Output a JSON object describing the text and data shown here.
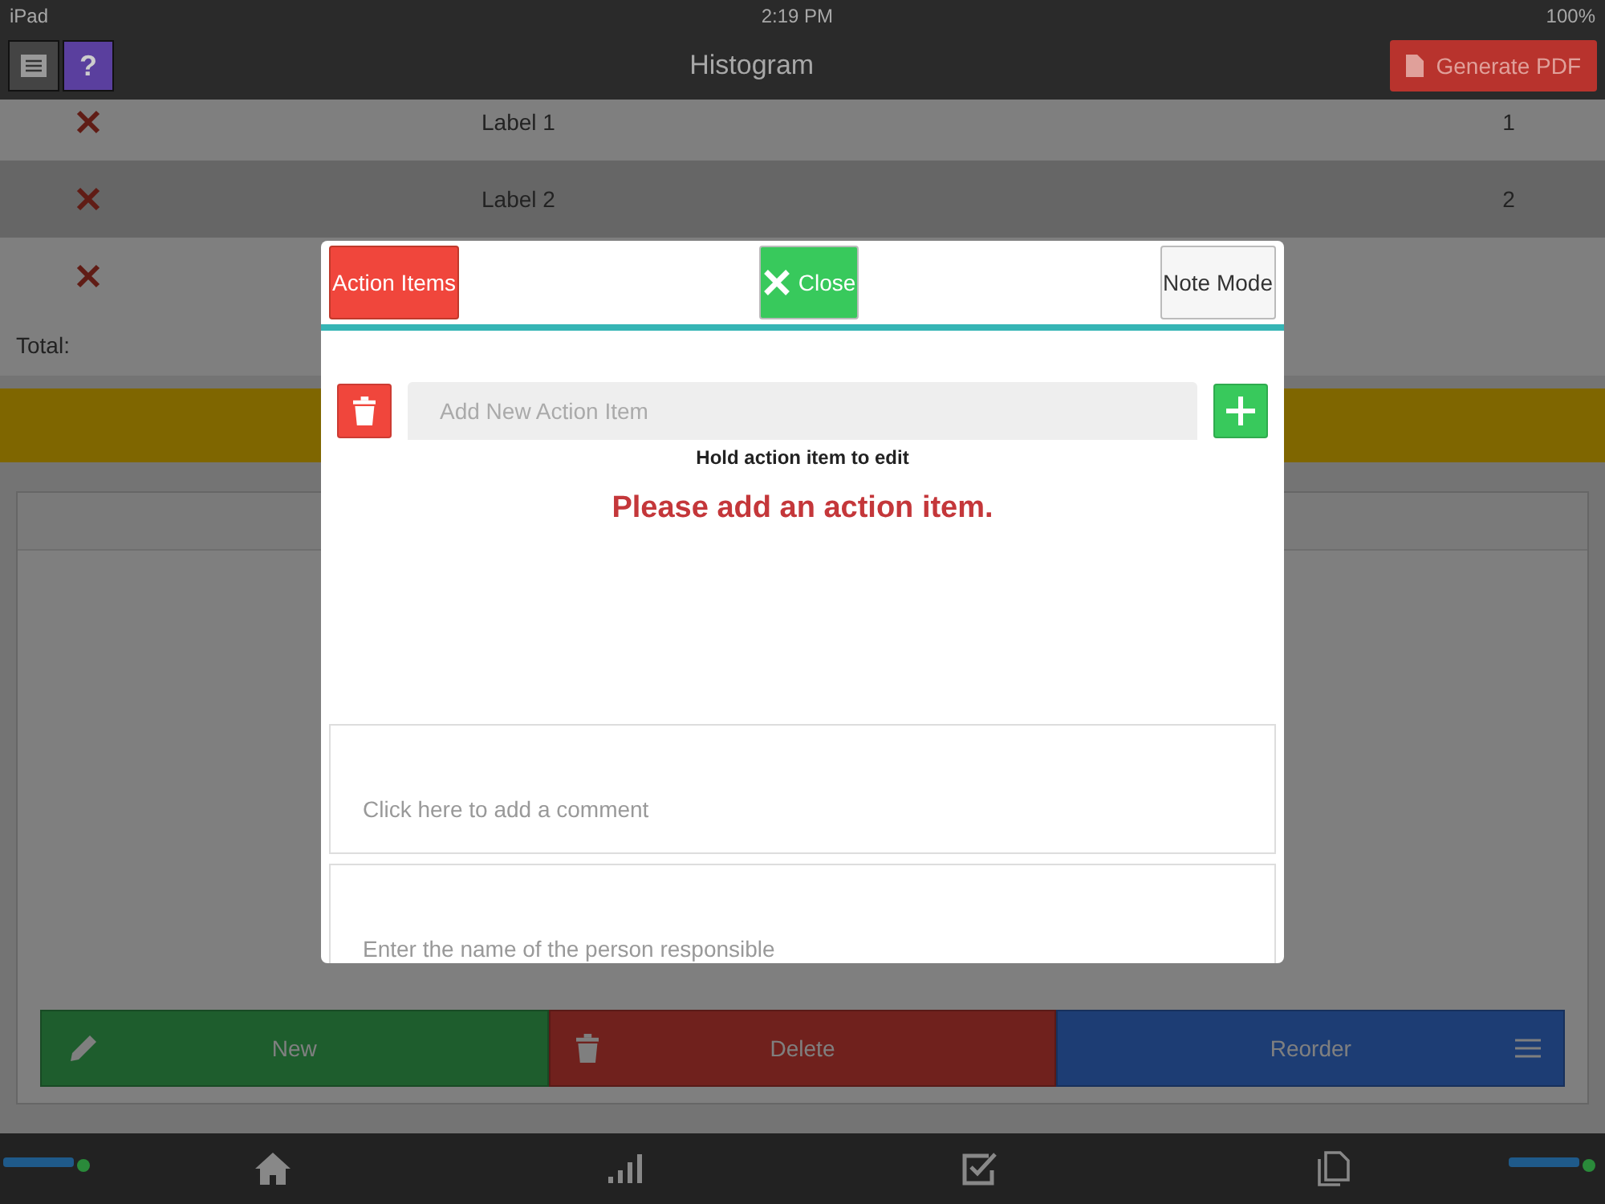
{
  "status_bar": {
    "device": "iPad",
    "time": "2:19 PM",
    "battery": "100%"
  },
  "top_bar": {
    "title": "Histogram",
    "generate_button": "Generate PDF",
    "help_button": "?"
  },
  "table": {
    "rows": [
      {
        "label": "Label 1",
        "value": "1",
        "removable": true
      },
      {
        "label": "Label 2",
        "value": "2",
        "removable": true
      },
      {
        "removable": true
      }
    ],
    "total_label": "Total:"
  },
  "actions": [
    {
      "kind": "new",
      "label": "New"
    },
    {
      "kind": "delete",
      "label": "Delete"
    },
    {
      "kind": "reorder",
      "label": "Reorder"
    }
  ],
  "tab_bar": [
    {
      "kind": "home"
    },
    {
      "kind": "chart"
    },
    {
      "kind": "checklist"
    },
    {
      "kind": "document"
    }
  ],
  "dialog": {
    "tabs": [
      {
        "kind": "action",
        "label": "Action Items",
        "selected": true
      },
      {
        "kind": "close",
        "label": "Close"
      },
      {
        "kind": "mode",
        "label": "Note Mode",
        "selected": false
      }
    ],
    "new_item_placeholder": "Add New Action Item",
    "hint": "Hold action item to edit",
    "empty_message": "Please add an action item.",
    "comment_placeholder": "Click here to add a comment",
    "person_placeholder": "Enter the name of the person responsible"
  }
}
